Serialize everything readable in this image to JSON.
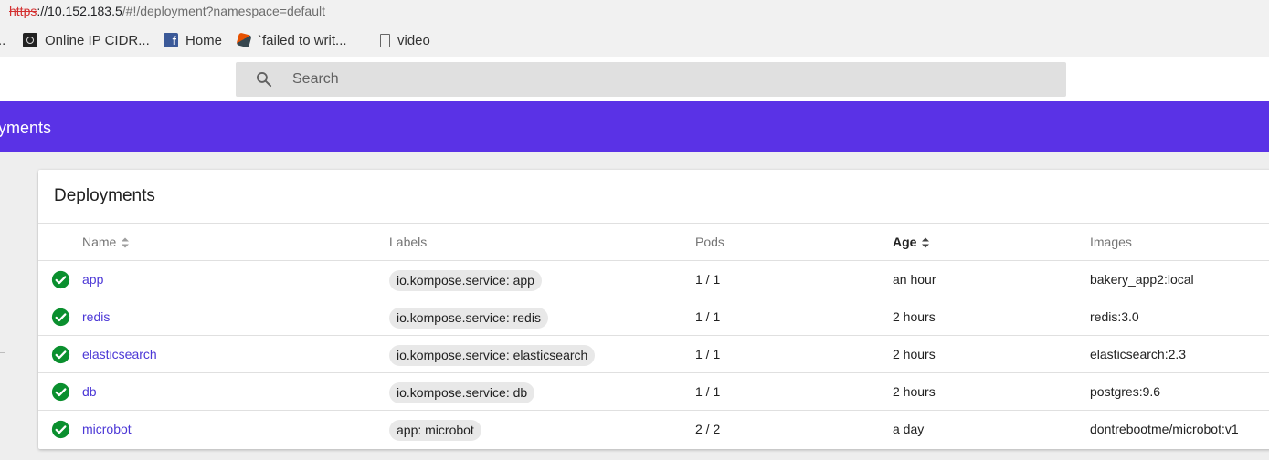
{
  "browser": {
    "url_scheme": "https",
    "url_host": "://10.152.183.5",
    "url_path": "/#!/deployment?namespace=default",
    "bookmarks": [
      {
        "label": "Online IP CIDR...",
        "icon": "cidr-icon"
      },
      {
        "label": "Home",
        "icon": "facebook-icon"
      },
      {
        "label": "`failed to writ...",
        "icon": "tool-icon"
      },
      {
        "label": "video",
        "icon": "page-icon"
      }
    ],
    "bookmarks_overflow": ".."
  },
  "search": {
    "placeholder": "Search",
    "icon": "search-icon"
  },
  "toolbar": {
    "title": "oyments",
    "color": "#5a32e6"
  },
  "card": {
    "title": "Deployments",
    "columns": {
      "name": "Name",
      "labels": "Labels",
      "pods": "Pods",
      "age": "Age",
      "images": "Images"
    },
    "sorted_column": "Age",
    "rows": [
      {
        "status": "running",
        "name": "app",
        "label": "io.kompose.service: app",
        "pods": "1 / 1",
        "age": "an hour",
        "image": "bakery_app2:local"
      },
      {
        "status": "running",
        "name": "redis",
        "label": "io.kompose.service: redis",
        "pods": "1 / 1",
        "age": "2 hours",
        "image": "redis:3.0"
      },
      {
        "status": "running",
        "name": "elasticsearch",
        "label": "io.kompose.service: elasticsearch",
        "pods": "1 / 1",
        "age": "2 hours",
        "image": "elasticsearch:2.3"
      },
      {
        "status": "running",
        "name": "db",
        "label": "io.kompose.service: db",
        "pods": "1 / 1",
        "age": "2 hours",
        "image": "postgres:9.6"
      },
      {
        "status": "running",
        "name": "microbot",
        "label": "app: microbot",
        "pods": "2 / 2",
        "age": "a day",
        "image": "dontrebootme/microbot:v1"
      }
    ]
  },
  "colors": {
    "accent": "#5a32e6",
    "link": "#4b37d6",
    "success": "#0a8f2e"
  }
}
